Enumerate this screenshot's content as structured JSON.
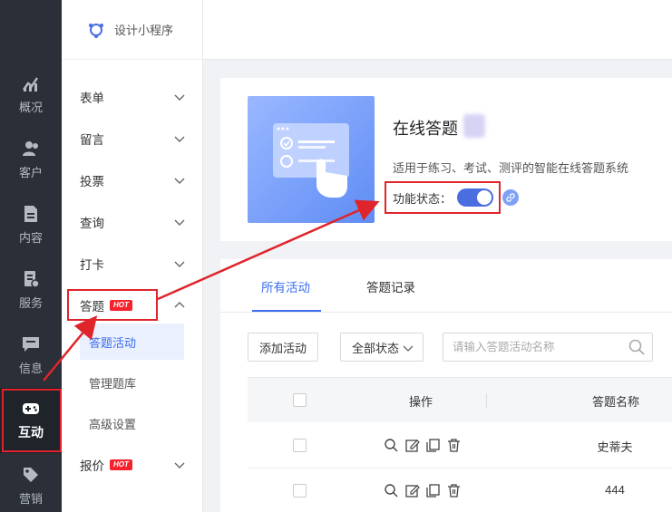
{
  "rail": {
    "items": [
      {
        "label": "概况",
        "icon": "chart-icon"
      },
      {
        "label": "客户",
        "icon": "users-icon"
      },
      {
        "label": "内容",
        "icon": "document-icon"
      },
      {
        "label": "服务",
        "icon": "service-icon"
      },
      {
        "label": "信息",
        "icon": "message-icon"
      },
      {
        "label": "互动",
        "icon": "gamepad-icon"
      },
      {
        "label": "营销",
        "icon": "tag-icon"
      }
    ],
    "active": "互动"
  },
  "brand": {
    "label": "设计小程序",
    "icon": "settings-hub-icon"
  },
  "subnav": {
    "groups": [
      {
        "label": "表单"
      },
      {
        "label": "留言"
      },
      {
        "label": "投票"
      },
      {
        "label": "查询"
      },
      {
        "label": "打卡"
      },
      {
        "label": "答题",
        "badge": "HOT"
      },
      {
        "label": "报价",
        "badge": "HOT"
      }
    ],
    "sub_items": [
      {
        "label": "答题活动"
      },
      {
        "label": "管理题库"
      },
      {
        "label": "高级设置"
      }
    ]
  },
  "app": {
    "title": "在线答题",
    "desc": "适用于练习、考试、测评的智能在线答题系统",
    "status_label": "功能状态：",
    "status_on": true
  },
  "tabs": [
    {
      "label": "所有活动",
      "active": true
    },
    {
      "label": "答题记录",
      "active": false
    }
  ],
  "toolbar": {
    "add_label": "添加活动",
    "filter_label": "全部状态",
    "search_placeholder": "请输入答题活动名称"
  },
  "table": {
    "headers": {
      "ops": "操作",
      "name": "答题名称"
    },
    "rows": [
      {
        "name": "史蒂夫"
      },
      {
        "name": "444"
      }
    ]
  },
  "colors": {
    "accent": "#3d6df0",
    "rail_bg": "#2a2f38",
    "annotation": "#e0242b",
    "hot": "#f5222d"
  }
}
